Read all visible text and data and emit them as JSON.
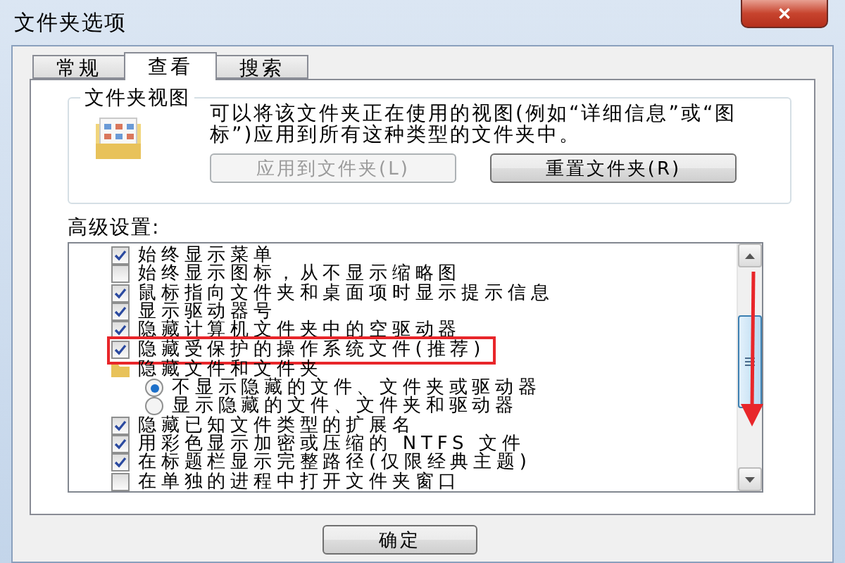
{
  "window": {
    "title": "文件夹选项",
    "close": "✕"
  },
  "tabs": [
    {
      "label": "常规",
      "selected": false
    },
    {
      "label": "查看",
      "selected": true
    },
    {
      "label": "搜索",
      "selected": false
    }
  ],
  "folder_views": {
    "title": "文件夹视图",
    "description": "可以将该文件夹正在使用的视图(例如“详细信息”或“图标”)应用到所有这种类型的文件夹中。",
    "buttons": [
      {
        "label": "应用到文件夹(L)",
        "disabled": true
      },
      {
        "label": "重置文件夹(R)",
        "disabled": false
      }
    ]
  },
  "advanced": {
    "title": "高级设置:",
    "items": [
      {
        "kind": "checkbox",
        "label": "始终显示菜单",
        "checked": true,
        "highlighted": false
      },
      {
        "kind": "checkbox",
        "label": "始终显示图标，从不显示缩略图",
        "checked": false,
        "highlighted": false
      },
      {
        "kind": "checkbox",
        "label": "鼠标指向文件夹和桌面项时显示提示信息",
        "checked": true,
        "highlighted": false
      },
      {
        "kind": "checkbox",
        "label": "显示驱动器号",
        "checked": true,
        "highlighted": false
      },
      {
        "kind": "checkbox",
        "label": "隐藏计算机文件夹中的空驱动器",
        "checked": true,
        "highlighted": false
      },
      {
        "kind": "checkbox",
        "label": "隐藏受保护的操作系统文件(推荐)",
        "checked": true,
        "highlighted": true
      },
      {
        "kind": "folder",
        "label": "隐藏文件和文件夹",
        "children": [
          {
            "kind": "radio",
            "label": "不显示隐藏的文件、文件夹或驱动器",
            "selected": true
          },
          {
            "kind": "radio",
            "label": "显示隐藏的文件、文件夹和驱动器",
            "selected": false
          }
        ]
      },
      {
        "kind": "checkbox",
        "label": "隐藏已知文件类型的扩展名",
        "checked": true,
        "highlighted": false
      },
      {
        "kind": "checkbox",
        "label": "用彩色显示加密或压缩的 NTFS 文件",
        "checked": true,
        "highlighted": false
      },
      {
        "kind": "checkbox",
        "label": "在标题栏显示完整路径(仅限经典主题)",
        "checked": true,
        "highlighted": false
      },
      {
        "kind": "checkbox",
        "label": "在单独的进程中打开文件夹窗口",
        "checked": false,
        "highlighted": false
      }
    ]
  },
  "footer": {
    "buttons": [
      {
        "label": "确定"
      }
    ]
  }
}
